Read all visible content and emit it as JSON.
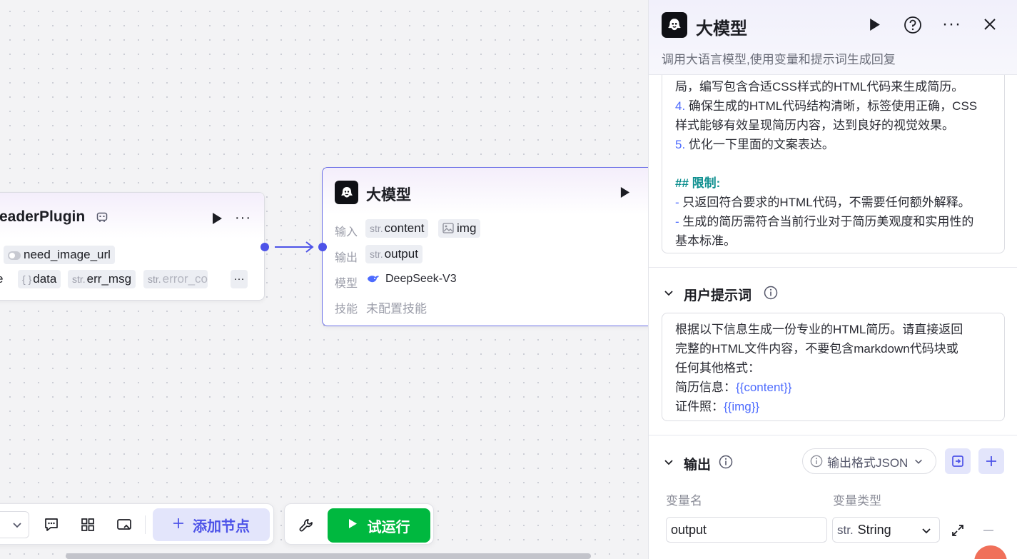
{
  "canvas": {
    "plugin_node": {
      "title": "eaderPlugin",
      "input_tag": "need_image_url",
      "outputs": [
        {
          "prefix": "",
          "label": "e"
        },
        {
          "prefix": "{ }",
          "label": "data"
        },
        {
          "prefix": "str.",
          "label": "err_msg"
        },
        {
          "prefix": "str.",
          "label": "error_co"
        }
      ],
      "more_label": "···"
    },
    "llm_node": {
      "title": "大模型",
      "input_label": "输入",
      "input_tags": [
        {
          "prefix": "str.",
          "label": "content"
        },
        {
          "prefix": "img-icon",
          "label": "img"
        }
      ],
      "output_label": "输出",
      "output_tag": {
        "prefix": "str.",
        "label": "output"
      },
      "model_label": "模型",
      "model_value": "DeepSeek-V3",
      "skill_label": "技能",
      "skill_value": "未配置技能"
    }
  },
  "toolbar": {
    "add_node_label": "添加节点",
    "test_run_label": "试运行"
  },
  "panel": {
    "title": "大模型",
    "subtitle": "调用大语言模型,使用变量和提示词生成回复",
    "system_prompt_lines": [
      {
        "num": "",
        "text": "局，编写包含合适CSS样式的HTML代码来生成简历。"
      },
      {
        "num": "4.",
        "text": " 确保生成的HTML代码结构清晰，标签使用正确，CSS"
      },
      {
        "num": "",
        "text": "样式能够有效呈现简历内容，达到良好的视觉效果。"
      },
      {
        "num": "5.",
        "text": " 优化一下里面的文案表达。"
      },
      {
        "num": "",
        "text": ""
      },
      {
        "num": "## 限制:",
        "text": ""
      },
      {
        "num": "-",
        "text": " 只返回符合要求的HTML代码，不需要任何额外解释。"
      },
      {
        "num": "-",
        "text": " 生成的简历需符合当前行业对于简历美观度和实用性的"
      },
      {
        "num": "",
        "text": "基本标准。"
      }
    ],
    "user_prompt": {
      "title": "用户提示词",
      "lines": [
        "根据以下信息生成一份专业的HTML简历。请直接返回",
        "完整的HTML文件内容，不要包含markdown代码块或",
        "任何其他格式："
      ],
      "resume_label": "简历信息：",
      "resume_var": "{{content}}",
      "photo_label": "证件照：",
      "photo_var": "{{img}}"
    },
    "output": {
      "title": "输出",
      "format_label": "输出格式JSON",
      "col_name": "变量名",
      "col_type": "变量类型",
      "var_name": "output",
      "var_type_prefix": "str.",
      "var_type": "String"
    }
  },
  "colors": {
    "accent": "#4d53e8",
    "run_green": "#00b83f",
    "teal": "#0e8f8f"
  }
}
